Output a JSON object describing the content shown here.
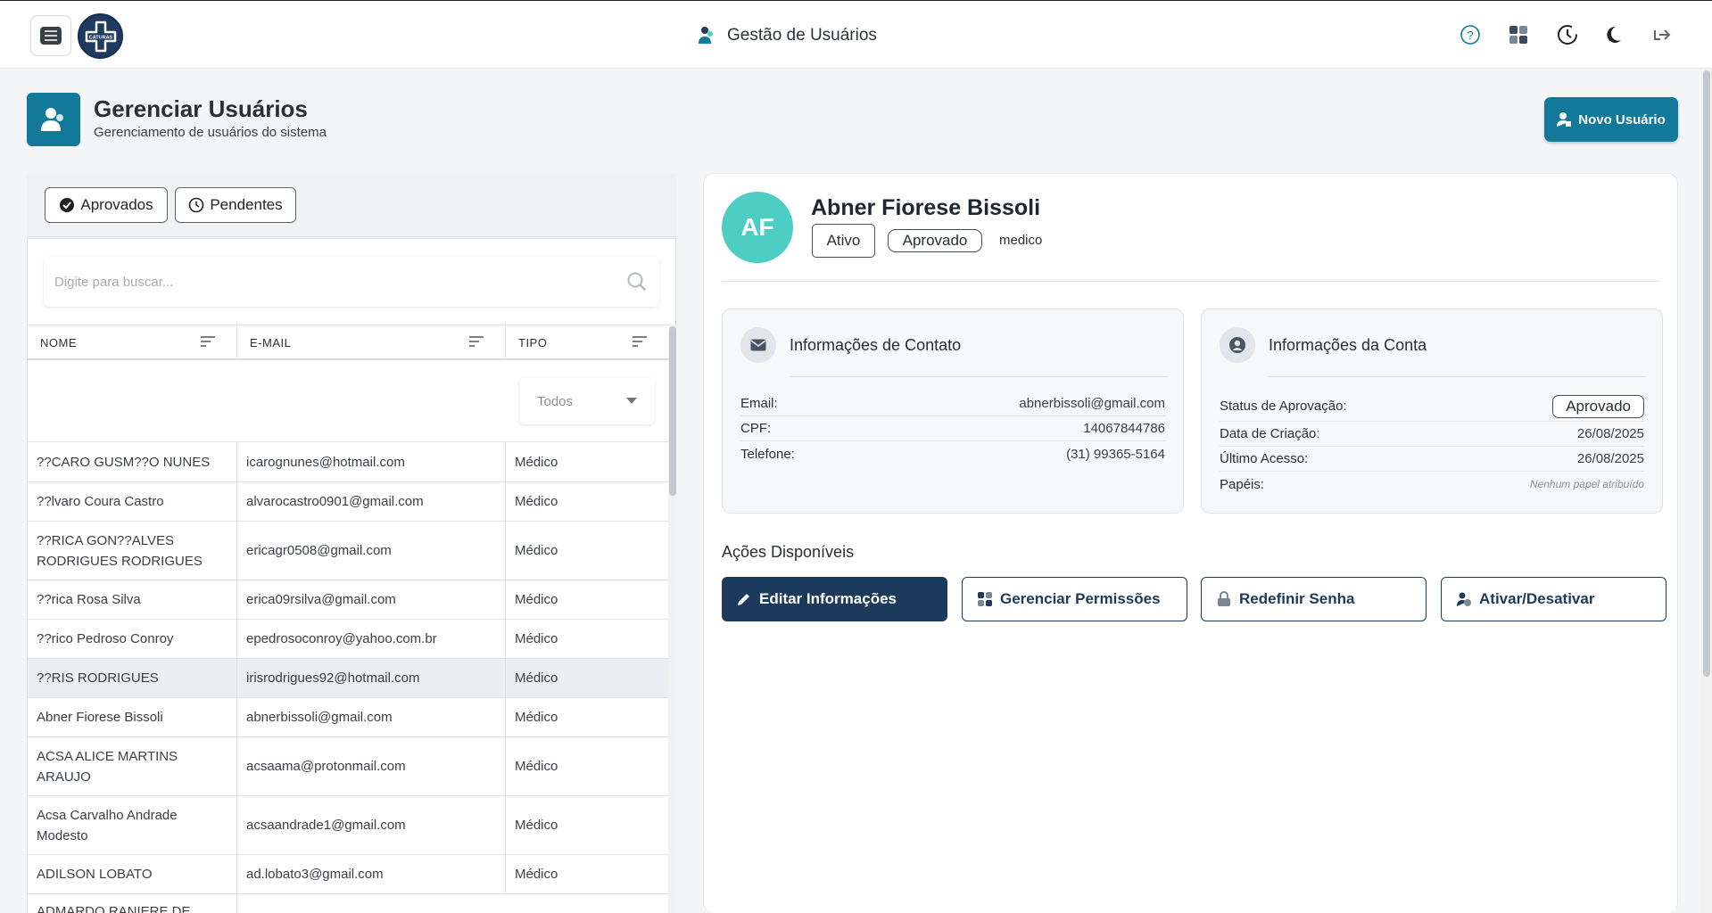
{
  "topbar": {
    "app_title": "Gestão de Usuários",
    "logo_text": "CATURAS"
  },
  "header": {
    "title": "Gerenciar Usuários",
    "subtitle": "Gerenciamento de usuários do sistema",
    "new_user_label": "Novo Usuário"
  },
  "tabs": {
    "approved_label": "Aprovados",
    "pending_label": "Pendentes"
  },
  "table": {
    "search_placeholder": "Digite para buscar...",
    "columns": [
      "NOME",
      "E-MAIL",
      "TIPO"
    ],
    "type_filter": "Todos",
    "rows": [
      {
        "name": "??CARO GUSM??O NUNES",
        "email": "icarognunes@hotmail.com",
        "type": "Médico"
      },
      {
        "name": "??lvaro Coura Castro",
        "email": "alvarocastro0901@gmail.com",
        "type": "Médico"
      },
      {
        "name": "??RICA GON??ALVES RODRIGUES RODRIGUES",
        "email": "ericagr0508@gmail.com",
        "type": "Médico"
      },
      {
        "name": "??rica Rosa Silva",
        "email": "erica09rsilva@gmail.com",
        "type": "Médico"
      },
      {
        "name": "??rico Pedroso Conroy",
        "email": "epedrosoconroy@yahoo.com.br",
        "type": "Médico"
      },
      {
        "name": "??RIS RODRIGUES",
        "email": "irisrodrigues92@hotmail.com",
        "type": "Médico"
      },
      {
        "name": "Abner Fiorese Bissoli",
        "email": "abnerbissoli@gmail.com",
        "type": "Médico"
      },
      {
        "name": "ACSA ALICE MARTINS ARAUJO",
        "email": "acsaama@protonmail.com",
        "type": "Médico"
      },
      {
        "name": "Acsa Carvalho Andrade Modesto",
        "email": "acsaandrade1@gmail.com",
        "type": "Médico"
      },
      {
        "name": "ADILSON LOBATO",
        "email": "ad.lobato3@gmail.com",
        "type": "Médico"
      },
      {
        "name": "ADMARDO RANIERE DE ASSIS",
        "email": "",
        "type": ""
      }
    ]
  },
  "detail": {
    "initials": "AF",
    "name": "Abner Fiorese Bissoli",
    "status_chip": "Ativo",
    "approval_chip": "Aprovado",
    "role": "medico",
    "contact": {
      "title": "Informações de Contato",
      "email_label": "Email:",
      "email": "abnerbissoli@gmail.com",
      "cpf_label": "CPF:",
      "cpf": "14067844786",
      "phone_label": "Telefone:",
      "phone": "(31) 99365-5164"
    },
    "account": {
      "title": "Informações da Conta",
      "approval_label": "Status de Aprovação:",
      "approval_value": "Aprovado",
      "created_label": "Data de Criação:",
      "created_value": "26/08/2025",
      "last_access_label": "Último Acesso:",
      "last_access_value": "26/08/2025",
      "roles_label": "Papéis:",
      "roles_value": "Nenhum papel atribuído"
    },
    "actions": {
      "title": "Ações Disponíveis",
      "edit": "Editar Informações",
      "permissions": "Gerenciar Permissões",
      "reset_password": "Redefinir Senha",
      "toggle": "Ativar/Desativar"
    }
  },
  "colors": {
    "accent": "#13799a",
    "navy": "#1b3a5c",
    "avatar": "#4ecdc4"
  }
}
